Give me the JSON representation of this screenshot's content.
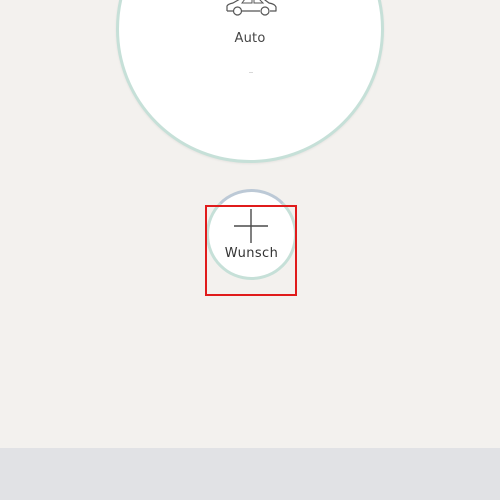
{
  "categories": {
    "auto": {
      "label": "Auto",
      "icon": "car-icon"
    },
    "wish": {
      "label": "Wunsch",
      "icon": "plus-icon"
    }
  },
  "colors": {
    "background": "#f3f1ee",
    "circle_border": "#c6e0d8",
    "highlight": "#e01b1b",
    "footer": "#e1e2e5"
  }
}
